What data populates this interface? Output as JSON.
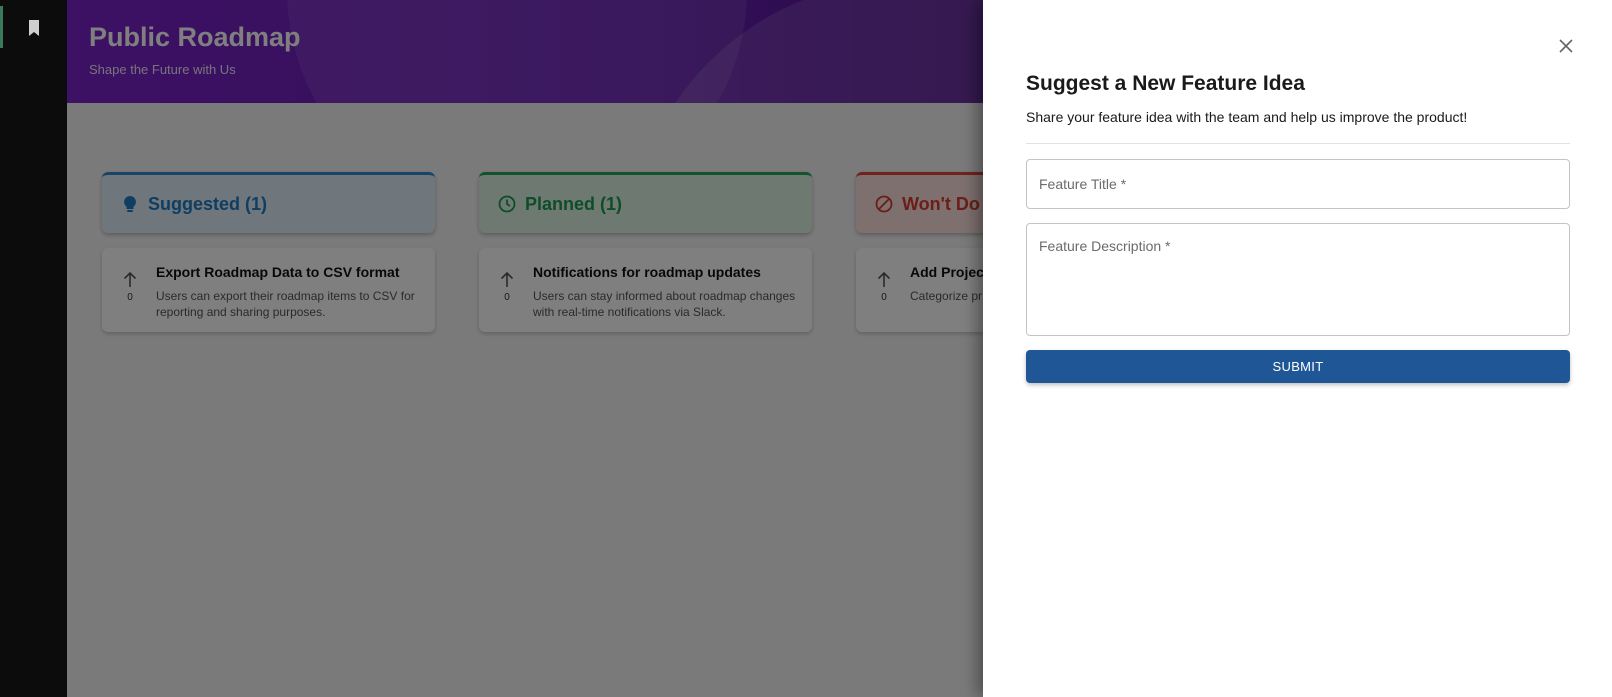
{
  "rail": {
    "icon": "bookmark-icon"
  },
  "hero": {
    "title": "Public Roadmap",
    "subtitle": "Shape the Future with Us"
  },
  "columns": [
    {
      "label": "Suggested (1)",
      "icon": "lightbulb-icon",
      "color": "#1f7cc4",
      "cards": [
        {
          "title": "Export Roadmap Data to CSV format",
          "desc": "Users can export their roadmap items to CSV for reporting and sharing purposes.",
          "votes": "0"
        }
      ]
    },
    {
      "label": "Planned (1)",
      "icon": "clock-icon",
      "color": "#1e9b52",
      "cards": [
        {
          "title": "Notifications for roadmap updates",
          "desc": "Users can stay informed about roadmap changes with real-time notifications via Slack.",
          "votes": "0"
        }
      ]
    },
    {
      "label": "Won't Do (",
      "icon": "ban-icon",
      "color": "#d83b30",
      "cards": [
        {
          "title": "Add Projec",
          "desc": "Categorize pr quickly filter r",
          "votes": "0"
        }
      ]
    }
  ],
  "drawer": {
    "title": "Suggest a New Feature Idea",
    "subtitle": "Share your feature idea with the team and help us improve the product!",
    "title_placeholder": "Feature Title *",
    "desc_placeholder": "Feature Description *",
    "submit_label": "SUBMIT",
    "close_icon": "close-icon",
    "accent": "#1f5696"
  }
}
